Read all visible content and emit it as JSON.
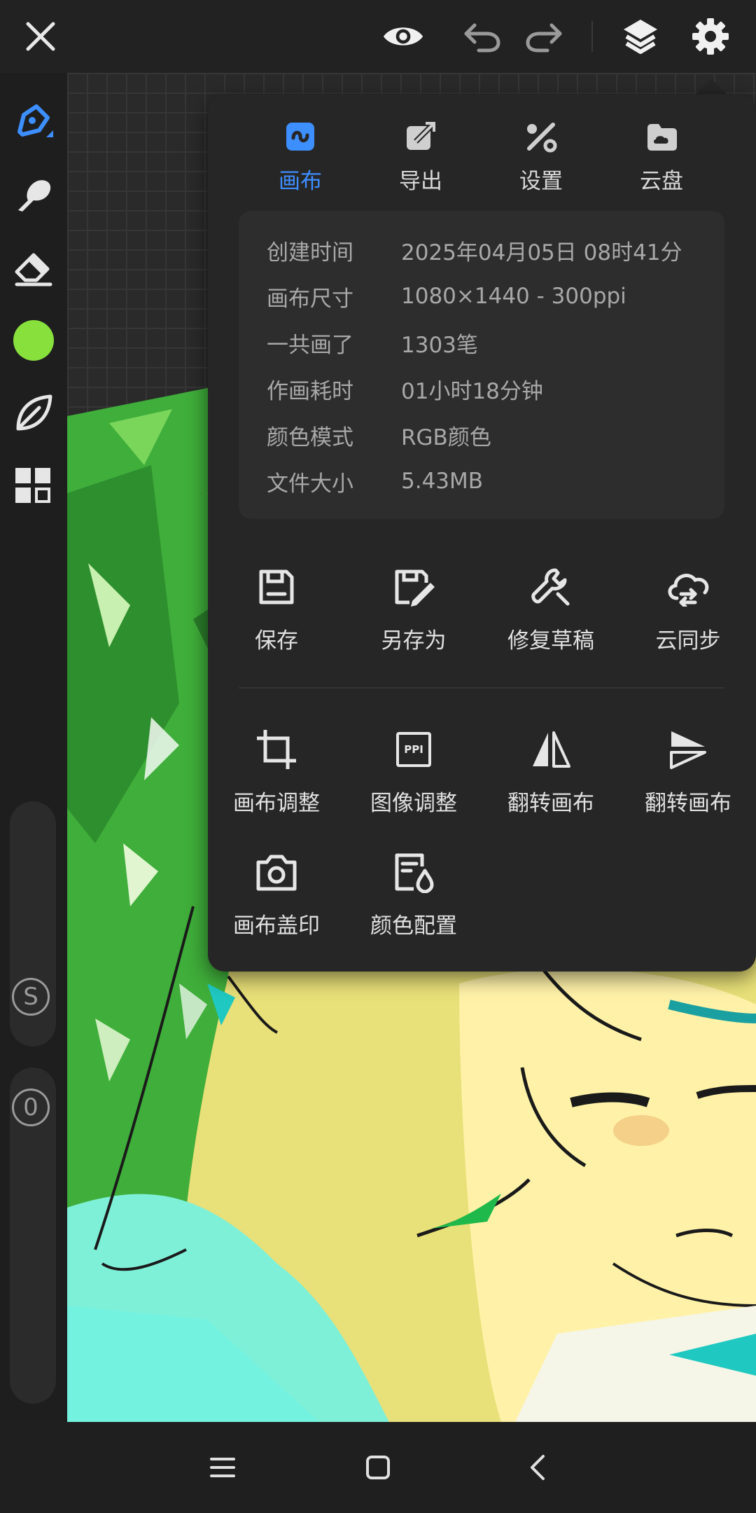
{
  "colors": {
    "accent": "#3d8eff",
    "brush_color": "#88e03c",
    "panel_bg": "#262626",
    "topbar_bg": "#222222"
  },
  "topbar": {
    "icons": [
      "close-icon",
      "eye-icon",
      "undo-icon",
      "redo-icon",
      "layers-icon",
      "settings-gear-icon"
    ]
  },
  "left_toolbar": {
    "tools": [
      "brush-icon",
      "smudge-icon",
      "eraser-icon",
      "color-swatch",
      "leaf-icon",
      "grid-icon"
    ],
    "size_badge": "S",
    "opacity_badge": "0"
  },
  "panel": {
    "tabs": [
      {
        "label": "画布",
        "icon": "canvas-icon",
        "active": true
      },
      {
        "label": "导出",
        "icon": "export-icon",
        "active": false
      },
      {
        "label": "设置",
        "icon": "settings-icon",
        "active": false
      },
      {
        "label": "云盘",
        "icon": "cloud-drive-icon",
        "active": false
      }
    ],
    "info": [
      {
        "key": "创建时间",
        "value": "2025年04月05日 08时41分"
      },
      {
        "key": "画布尺寸",
        "value": "1080×1440 - 300ppi"
      },
      {
        "key": "一共画了",
        "value": "1303笔"
      },
      {
        "key": "作画耗时",
        "value": "01小时18分钟"
      },
      {
        "key": "颜色模式",
        "value": "RGB颜色"
      },
      {
        "key": "文件大小",
        "value": "5.43MB"
      }
    ],
    "actions_row1": [
      {
        "label": "保存",
        "icon": "save-icon"
      },
      {
        "label": "另存为",
        "icon": "save-as-icon"
      },
      {
        "label": "修复草稿",
        "icon": "wrench-icon"
      },
      {
        "label": "云同步",
        "icon": "cloud-sync-icon"
      }
    ],
    "actions_row2": [
      {
        "label": "画布调整",
        "icon": "crop-icon"
      },
      {
        "label": "图像调整",
        "icon": "ppi-icon",
        "icon_text": "PPI"
      },
      {
        "label": "翻转画布",
        "icon": "flip-horizontal-icon"
      },
      {
        "label": "翻转画布",
        "icon": "flip-vertical-icon"
      }
    ],
    "actions_row3": [
      {
        "label": "画布盖印",
        "icon": "camera-icon"
      },
      {
        "label": "颜色配置",
        "icon": "color-profile-icon"
      }
    ]
  },
  "navbar": {
    "icons": [
      "menu-icon",
      "home-icon",
      "back-icon"
    ]
  }
}
